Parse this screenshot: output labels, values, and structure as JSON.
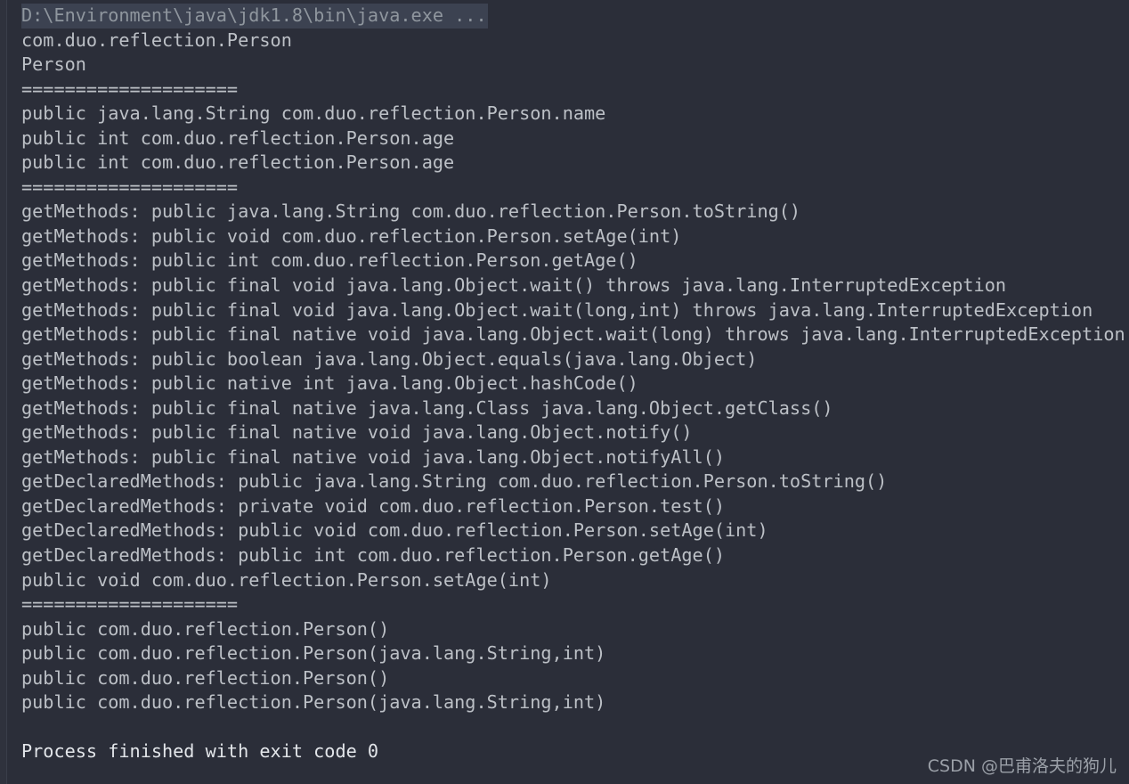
{
  "console": {
    "background_color": "#2b2e39",
    "text_color": "#bcc0c6",
    "command_color": "#8f969e",
    "command_highlight_color": "#3c4251",
    "finish_color": "#e3e6ea",
    "command_line": "D:\\Environment\\java\\jdk1.8\\bin\\java.exe ...",
    "lines": [
      "com.duo.reflection.Person",
      "Person",
      "====================",
      "public java.lang.String com.duo.reflection.Person.name",
      "public int com.duo.reflection.Person.age",
      "public int com.duo.reflection.Person.age",
      "====================",
      "getMethods: public java.lang.String com.duo.reflection.Person.toString()",
      "getMethods: public void com.duo.reflection.Person.setAge(int)",
      "getMethods: public int com.duo.reflection.Person.getAge()",
      "getMethods: public final void java.lang.Object.wait() throws java.lang.InterruptedException",
      "getMethods: public final void java.lang.Object.wait(long,int) throws java.lang.InterruptedException",
      "getMethods: public final native void java.lang.Object.wait(long) throws java.lang.InterruptedException",
      "getMethods: public boolean java.lang.Object.equals(java.lang.Object)",
      "getMethods: public native int java.lang.Object.hashCode()",
      "getMethods: public final native java.lang.Class java.lang.Object.getClass()",
      "getMethods: public final native void java.lang.Object.notify()",
      "getMethods: public final native void java.lang.Object.notifyAll()",
      "getDeclaredMethods: public java.lang.String com.duo.reflection.Person.toString()",
      "getDeclaredMethods: private void com.duo.reflection.Person.test()",
      "getDeclaredMethods: public void com.duo.reflection.Person.setAge(int)",
      "getDeclaredMethods: public int com.duo.reflection.Person.getAge()",
      "public void com.duo.reflection.Person.setAge(int)",
      "====================",
      "public com.duo.reflection.Person()",
      "public com.duo.reflection.Person(java.lang.String,int)",
      "public com.duo.reflection.Person()",
      "public com.duo.reflection.Person(java.lang.String,int)",
      ""
    ],
    "finish_line": "Process finished with exit code 0"
  },
  "watermark": {
    "text": "CSDN @巴甫洛夫的狗儿"
  }
}
